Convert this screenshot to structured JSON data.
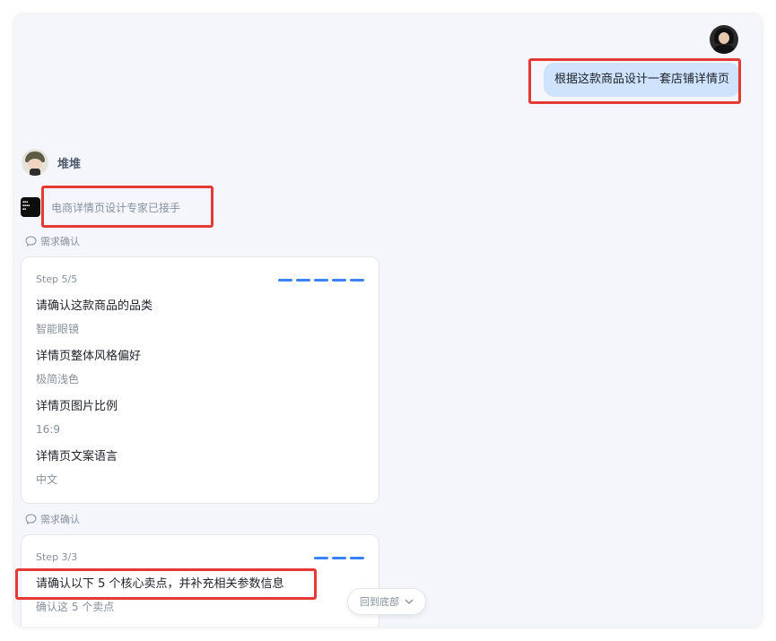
{
  "user": {
    "avatar_icon": "user-avatar-icon",
    "message": "根据这款商品设计一套店铺详情页"
  },
  "bot": {
    "avatar_icon": "bot-avatar-icon",
    "name": "堆堆"
  },
  "agent": {
    "icon": "agent-logo-icon",
    "status": "电商详情页设计专家已接手"
  },
  "sections": [
    {
      "label": "需求确认",
      "step": "Step 5/5",
      "dashes": 5,
      "items": [
        {
          "question": "请确认这款商品的品类",
          "answer": "智能眼镜"
        },
        {
          "question": "详情页整体风格偏好",
          "answer": "极简浅色"
        },
        {
          "question": "详情页图片比例",
          "answer": "16:9"
        },
        {
          "question": "详情页文案语言",
          "answer": "中文"
        }
      ]
    },
    {
      "label": "需求确认",
      "step": "Step 3/3",
      "dashes": 3,
      "items": [
        {
          "question": "请确认以下 5 个核心卖点，并补充相关参数信息",
          "answer": "确认这 5 个卖点"
        }
      ]
    }
  ],
  "scroll_button": {
    "label": "回到底部",
    "icon": "chevron-down-icon"
  },
  "colors": {
    "accent": "#3b82f6",
    "user_bubble": "#cfe3fd",
    "highlight": "#e53935"
  }
}
